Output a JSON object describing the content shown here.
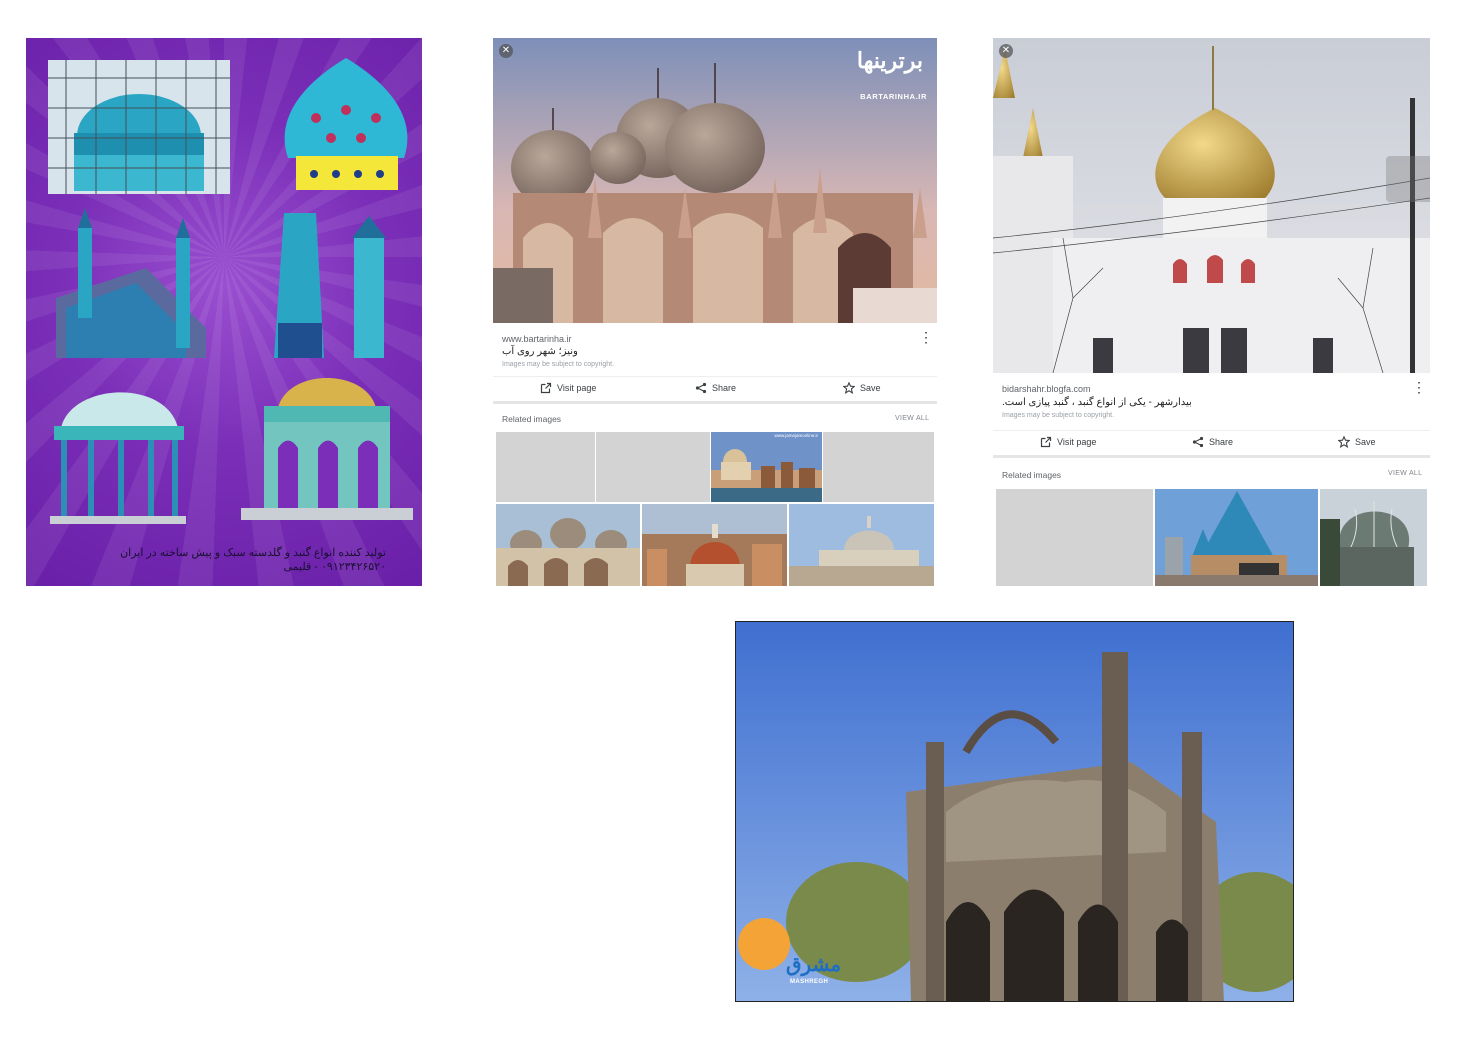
{
  "poster": {
    "caption_line1": "تولید کننده انواع گنبد و گلدسته سبک و پیش ساخته در ایران",
    "caption_line2": "۰۹۱۲۳۴۲۶۵۲۰ - قلیمی"
  },
  "card1": {
    "watermark_brand": "برترینها",
    "watermark_url": "BARTARINHA.IR",
    "domain": "www.bartarinha.ir",
    "title": "ونیز؛ شهر روی آب",
    "copyright": "Images may be subject to copyright.",
    "actions": {
      "visit": "Visit page",
      "share": "Share",
      "save": "Save"
    },
    "related_label": "Related images",
    "view_all": "VIEW ALL",
    "thumb_watermark": "www.jamejamonline.ir"
  },
  "card2": {
    "domain": "bidarshahr.blogfa.com",
    "title": "بیدارشهر - یکی از انواع گنبد ، گنبد پیازی است.",
    "copyright": "Images may be subject to copyright.",
    "actions": {
      "visit": "Visit page",
      "share": "Share",
      "save": "Save"
    },
    "related_label": "Related images",
    "view_all": "VIEW ALL"
  },
  "mosque": {
    "logo_text": "مشرق",
    "logo_sub": "MASHREGH"
  },
  "icons": {
    "close": "close-icon",
    "more": "more-vert-icon",
    "visit": "open-in-new-icon",
    "share": "share-icon",
    "save": "star-icon"
  },
  "colors": {
    "poster_bg": "#7b2fb8",
    "dome_turquoise": "#2fb7d6",
    "sky_venice": "#c9b8c8",
    "sky_mosque": "#4a7fd6",
    "text_primary": "#202124",
    "text_secondary": "#5f6368"
  }
}
